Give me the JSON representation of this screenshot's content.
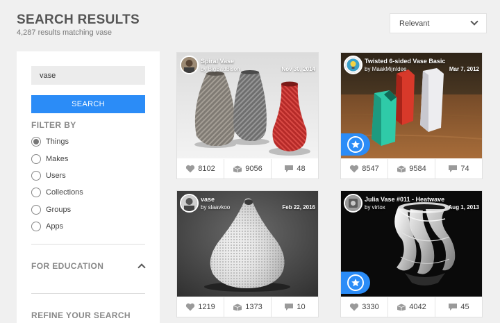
{
  "header": {
    "title": "SEARCH RESULTS",
    "subtitle": "4,287 results matching vase"
  },
  "sort": {
    "selected": "Relevant"
  },
  "sidebar": {
    "search_value": "vase",
    "search_button": "SEARCH",
    "filter_heading": "FILTER BY",
    "filters": [
      {
        "label": "Things",
        "checked": true
      },
      {
        "label": "Makes",
        "checked": false
      },
      {
        "label": "Users",
        "checked": false
      },
      {
        "label": "Collections",
        "checked": false
      },
      {
        "label": "Groups",
        "checked": false
      },
      {
        "label": "Apps",
        "checked": false
      }
    ],
    "education_heading": "FOR EDUCATION",
    "refine_heading": "REFINE YOUR SEARCH"
  },
  "results": [
    {
      "title": "Spiral Vase",
      "author": "by BigBadBison",
      "date": "Nov 30, 2014",
      "likes": "8102",
      "collects": "9056",
      "comments": "48",
      "featured": false
    },
    {
      "title": "Twisted 6-sided Vase Basic",
      "author": "by MaakMijnIdee",
      "date": "Mar 7, 2012",
      "likes": "8547",
      "collects": "9584",
      "comments": "74",
      "featured": true
    },
    {
      "title": "vase",
      "author": "by slaavkoo",
      "date": "Feb 22, 2016",
      "likes": "1219",
      "collects": "1373",
      "comments": "10",
      "featured": false
    },
    {
      "title": "Julia Vase #011 - Heatwave",
      "author": "by virtox",
      "date": "Aug 1, 2013",
      "likes": "3330",
      "collects": "4042",
      "comments": "45",
      "featured": true
    }
  ],
  "colors": {
    "accent": "#2b8cf7",
    "background": "#f0f0f0"
  },
  "icons": {
    "likes": "heart-icon",
    "collects": "collection-icon",
    "comments": "comment-icon",
    "featured": "star-icon"
  }
}
